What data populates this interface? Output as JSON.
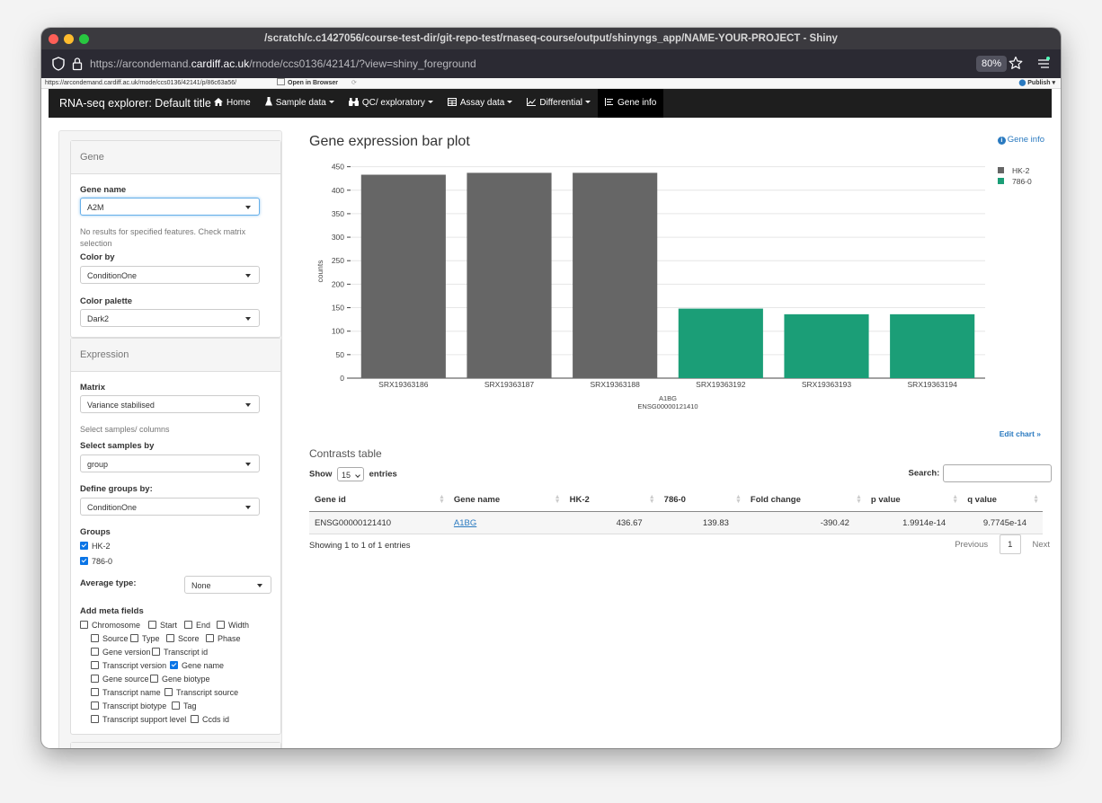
{
  "window": {
    "title": "/scratch/c.c1427056/course-test-dir/git-repo-test/rnaseq-course/output/shinyngs_app/NAME-YOUR-PROJECT - Shiny"
  },
  "browser": {
    "url_prefix": "https://arcondemand.",
    "url_domain": "cardiff.ac.uk",
    "url_path": "/rnode/ccs0136/42141/?view=shiny_foreground",
    "zoom": "80%",
    "status_url": "https://arcondemand.cardiff.ac.uk/rnode/ccs0136/42141/p/86c63a56/",
    "open_in_browser": "Open in Browser",
    "publish": "Publish"
  },
  "navbar": {
    "brand": "RNA-seq explorer: Default title",
    "items": [
      {
        "label": "Home",
        "icon": "home-icon",
        "dropdown": false,
        "active": false
      },
      {
        "label": "Sample data",
        "icon": "flask-icon",
        "dropdown": true,
        "active": false
      },
      {
        "label": "QC/ exploratory",
        "icon": "binoculars-icon",
        "dropdown": true,
        "active": false
      },
      {
        "label": "Assay data",
        "icon": "table-icon",
        "dropdown": true,
        "active": false
      },
      {
        "label": "Differential",
        "icon": "line-chart-icon",
        "dropdown": true,
        "active": false
      },
      {
        "label": "Gene info",
        "icon": "align-left-icon",
        "dropdown": false,
        "active": true
      }
    ]
  },
  "sidebar": {
    "gene_panel": {
      "title": "Gene",
      "gene_name_label": "Gene name",
      "gene_name_value": "A2M",
      "help_text": "No results for specified features. Check matrix selection",
      "color_by_label": "Color by",
      "color_by_value": "ConditionOne",
      "palette_label": "Color palette",
      "palette_value": "Dark2"
    },
    "expression_panel": {
      "title": "Expression",
      "matrix_label": "Matrix",
      "matrix_value": "Variance stabilised",
      "select_help": "Select samples/ columns",
      "select_by_label": "Select samples by",
      "select_by_value": "group",
      "define_groups_label": "Define groups by:",
      "define_groups_value": "ConditionOne",
      "groups_label": "Groups",
      "groups": [
        {
          "label": "HK-2",
          "checked": true
        },
        {
          "label": "786-0",
          "checked": true
        }
      ],
      "average_label": "Average type:",
      "average_value": "None",
      "meta_label": "Add meta fields",
      "meta_fields": [
        {
          "label": "Chromosome",
          "checked": false
        },
        {
          "label": "Start",
          "checked": false
        },
        {
          "label": "End",
          "checked": false
        },
        {
          "label": "Width",
          "checked": false
        },
        {
          "label": "Source",
          "checked": false
        },
        {
          "label": "Type",
          "checked": false
        },
        {
          "label": "Score",
          "checked": false
        },
        {
          "label": "Phase",
          "checked": false
        },
        {
          "label": "Gene version",
          "checked": false
        },
        {
          "label": "Transcript id",
          "checked": false
        },
        {
          "label": "Transcript version",
          "checked": false
        },
        {
          "label": "Gene name",
          "checked": true
        },
        {
          "label": "Gene source",
          "checked": false
        },
        {
          "label": "Gene biotype",
          "checked": false
        },
        {
          "label": "Transcript name",
          "checked": false
        },
        {
          "label": "Transcript source",
          "checked": false
        },
        {
          "label": "Transcript biotype",
          "checked": false
        },
        {
          "label": "Tag",
          "checked": false
        },
        {
          "label": "Transcript support level",
          "checked": false
        },
        {
          "label": "Ccds id",
          "checked": false
        }
      ]
    }
  },
  "main": {
    "title": "Gene expression bar plot",
    "gene_info_link": "Gene info",
    "edit_chart": "Edit chart »",
    "contrasts_title": "Contrasts table",
    "show_label": "Show",
    "show_value": "15",
    "entries_label": "entries",
    "search_label": "Search:",
    "table": {
      "headers": [
        "Gene id",
        "Gene name",
        "HK-2",
        "786-0",
        "Fold change",
        "p value",
        "q value"
      ],
      "rows": [
        [
          "ENSG00000121410",
          "A1BG",
          "436.67",
          "139.83",
          "-390.42",
          "1.9914e-14",
          "9.7745e-14"
        ]
      ]
    },
    "info": "Showing 1 to 1 of 1 entries",
    "pager": {
      "previous": "Previous",
      "current": "1",
      "next": "Next"
    }
  },
  "chart_data": {
    "type": "bar",
    "categories": [
      "SRX19363186",
      "SRX19363187",
      "SRX19363188",
      "SRX19363192",
      "SRX19363193",
      "SRX19363194"
    ],
    "values": [
      433,
      437,
      437,
      148,
      136,
      136
    ],
    "groups": [
      "HK-2",
      "HK-2",
      "HK-2",
      "786-0",
      "786-0",
      "786-0"
    ],
    "legend": [
      {
        "name": "HK-2",
        "color": "#666666"
      },
      {
        "name": "786-0",
        "color": "#1b9e77"
      }
    ],
    "xlabel_lines": [
      "A1BG",
      "ENSG00000121410"
    ],
    "ylabel": "counts",
    "yticks": [
      0,
      50,
      100,
      150,
      200,
      250,
      300,
      350,
      400,
      450
    ],
    "ylim": [
      0,
      455
    ],
    "legend_position": "top-right"
  }
}
